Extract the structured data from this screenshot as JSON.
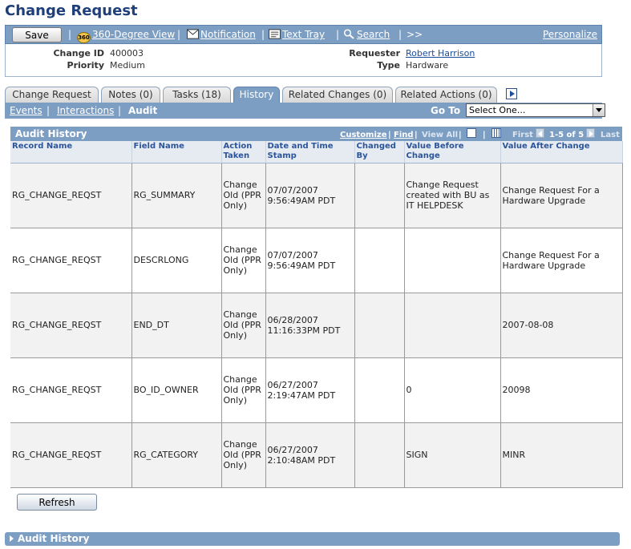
{
  "page": {
    "title": "Change Request"
  },
  "toolbar": {
    "save_label": "Save",
    "view_360": "360-Degree View",
    "notification": "Notification",
    "text_tray": "Text Tray",
    "search": "Search",
    "more": ">>",
    "personalize": "Personalize",
    "icon_360_text": "360"
  },
  "header": {
    "change_id_label": "Change ID",
    "change_id": "400003",
    "priority_label": "Priority",
    "priority": "Medium",
    "requester_label": "Requester",
    "requester": "Robert Harrison",
    "type_label": "Type",
    "type": "Hardware"
  },
  "tabs": [
    {
      "label": "Change Request",
      "active": false
    },
    {
      "label": "Notes (0)",
      "active": false
    },
    {
      "label": "Tasks (18)",
      "active": false
    },
    {
      "label": "History",
      "active": true
    },
    {
      "label": "Related Changes (0)",
      "active": false
    },
    {
      "label": "Related Actions (0)",
      "active": false
    }
  ],
  "subnav": {
    "events": "Events",
    "interactions": "Interactions",
    "audit": "Audit",
    "sep": "|",
    "goto_label": "Go To",
    "goto_value": "Select One..."
  },
  "grid": {
    "title": "Audit History",
    "customize": "Customize",
    "find": "Find",
    "view_all": "View All",
    "first": "First",
    "range": "1-5 of 5",
    "last": "Last",
    "sep": "|",
    "columns": [
      "Record Name",
      "Field Name",
      "Action Taken",
      "Date and Time Stamp",
      "Changed By",
      "Value Before Change",
      "Value After Change"
    ],
    "rows": [
      {
        "record": "RG_CHANGE_REQST",
        "field": "RG_SUMMARY",
        "action": "Change Old (PPR Only)",
        "stamp": "07/07/2007 9:56:49AM PDT",
        "changed_by": "",
        "before": "Change Request created with BU as IT HELPDESK",
        "after": "Change Request For a Hardware Upgrade"
      },
      {
        "record": "RG_CHANGE_REQST",
        "field": "DESCRLONG",
        "action": "Change Old (PPR Only)",
        "stamp": "07/07/2007 9:56:49AM PDT",
        "changed_by": "",
        "before": "",
        "after": "Change Request For a Hardware Upgrade"
      },
      {
        "record": "RG_CHANGE_REQST",
        "field": "END_DT",
        "action": "Change Old (PPR Only)",
        "stamp": "06/28/2007 11:16:33PM PDT",
        "changed_by": "",
        "before": "",
        "after": "2007-08-08"
      },
      {
        "record": "RG_CHANGE_REQST",
        "field": "BO_ID_OWNER",
        "action": "Change Old (PPR Only)",
        "stamp": "06/27/2007 2:19:47AM PDT",
        "changed_by": "",
        "before": "0",
        "after": "20098"
      },
      {
        "record": "RG_CHANGE_REQST",
        "field": "RG_CATEGORY",
        "action": "Change Old (PPR Only)",
        "stamp": "06/27/2007 2:10:48AM PDT",
        "changed_by": "",
        "before": "SIGN",
        "after": "MINR"
      }
    ]
  },
  "actions": {
    "refresh_label": "Refresh"
  },
  "collapsed": {
    "label": "Audit History"
  },
  "colors": {
    "accent": "#7d9ec3",
    "title": "#1f3f7a",
    "link": "#1a4c99",
    "header_text": "#2c5499"
  }
}
